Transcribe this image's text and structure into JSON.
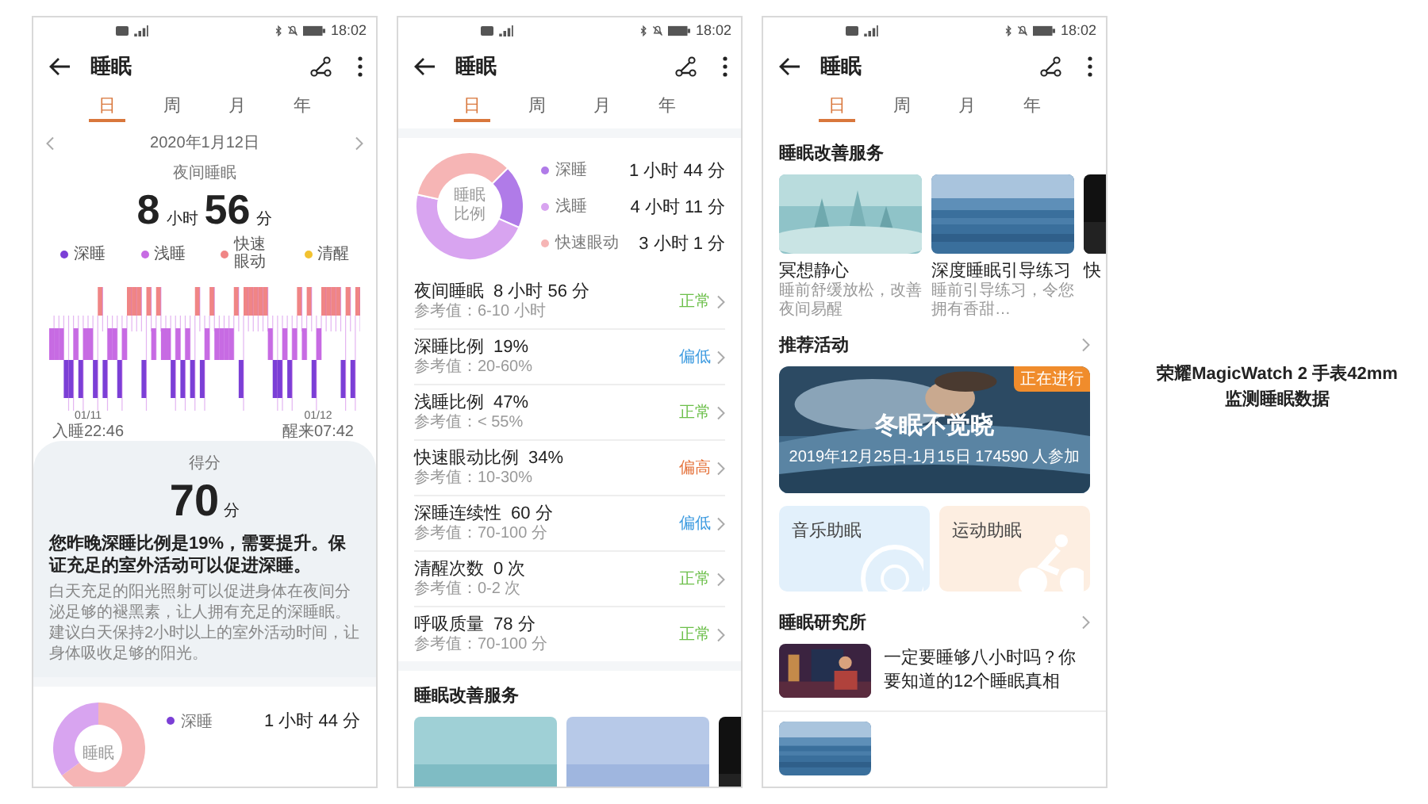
{
  "screens": [
    {
      "kind": "overview",
      "status_time": "18:02",
      "title": "睡眠",
      "tabs": [
        {
          "label": "日",
          "selected": true
        },
        {
          "label": "周",
          "selected": false
        },
        {
          "label": "月",
          "selected": false
        },
        {
          "label": "年",
          "selected": false
        }
      ],
      "date": "2020年1月12日",
      "night_label": "夜间睡眠",
      "duration": {
        "hours": "8",
        "hours_unit": "小时",
        "minutes": "56",
        "minutes_unit": "分"
      },
      "legend": [
        {
          "label": "深睡",
          "color": "#7b3fd6"
        },
        {
          "label": "浅睡",
          "color": "#c76be3"
        },
        {
          "label": "快速眼动",
          "color": "#f08585"
        },
        {
          "label": "清醒",
          "color": "#f2c230"
        }
      ],
      "chart_start": {
        "date": "01/11",
        "label": "入睡22:46"
      },
      "chart_end": {
        "date": "01/12",
        "label": "醒来07:42"
      },
      "score": {
        "label": "得分",
        "value": "70",
        "unit": "分"
      },
      "advice_title": "您昨晚深睡比例是19%，需要提升。保证充足的室外活动可以促进深睡。",
      "advice_body": "白天充足的阳光照射可以促进身体在夜间分泌足够的褪黑素，让人拥有充足的深睡眠。建议白天保持2小时以上的室外活动时间，让身体吸收足够的阳光。",
      "breakdown": {
        "center_label": "睡眠",
        "rows": [
          {
            "label": "深睡",
            "value": "1 小时 44 分",
            "color": "#7b3fd6"
          }
        ]
      }
    },
    {
      "kind": "details",
      "status_time": "18:02",
      "title": "睡眠",
      "tabs": [
        {
          "label": "日",
          "selected": true
        },
        {
          "label": "周",
          "selected": false
        },
        {
          "label": "月",
          "selected": false
        },
        {
          "label": "年",
          "selected": false
        }
      ],
      "chart_data": {
        "type": "donut",
        "title": "睡眠比例",
        "categories": [
          "深睡",
          "浅睡",
          "快速眼动"
        ],
        "values": [
          19,
          47,
          34
        ],
        "colors": [
          "#b07be8",
          "#d8a4f0",
          "#f6b5b5"
        ]
      },
      "durations": [
        "1 小时 44 分",
        "4 小时 11 分",
        "3 小时 1 分"
      ],
      "metrics": [
        {
          "title": "夜间睡眠",
          "value": "8 小时 56 分",
          "reference": "参考值：6-10 小时",
          "status": "正常",
          "color": "#6cbf4a"
        },
        {
          "title": "深睡比例",
          "value": "19%",
          "reference": "参考值：20-60%",
          "status": "偏低",
          "color": "#3d9be0"
        },
        {
          "title": "浅睡比例",
          "value": "47%",
          "reference": "参考值：< 55%",
          "status": "正常",
          "color": "#6cbf4a"
        },
        {
          "title": "快速眼动比例",
          "value": "34%",
          "reference": "参考值：10-30%",
          "status": "偏高",
          "color": "#e5743e"
        },
        {
          "title": "深睡连续性",
          "value": "60 分",
          "reference": "参考值：70-100 分",
          "status": "偏低",
          "color": "#3d9be0"
        },
        {
          "title": "清醒次数",
          "value": "0 次",
          "reference": "参考值：0-2 次",
          "status": "正常",
          "color": "#6cbf4a"
        },
        {
          "title": "呼吸质量",
          "value": "78 分",
          "reference": "参考值：70-100 分",
          "status": "正常",
          "color": "#6cbf4a"
        }
      ],
      "services_heading": "睡眠改善服务",
      "service_cards": [
        {
          "kind": "picture"
        },
        {
          "kind": "picture"
        },
        {
          "kind": "picture"
        }
      ]
    },
    {
      "kind": "services",
      "status_time": "18:02",
      "title": "睡眠",
      "tabs": [
        {
          "label": "日",
          "selected": true
        },
        {
          "label": "周",
          "selected": false
        },
        {
          "label": "月",
          "selected": false
        },
        {
          "label": "年",
          "selected": false
        }
      ],
      "services_heading": "睡眠改善服务",
      "service_cards": [
        {
          "title": "冥想静心",
          "subtitle": "睡前舒缓放松，改善夜间易醒"
        },
        {
          "title": "深度睡眠引导练习",
          "subtitle": "睡前引导练习，令您拥有香甜…"
        },
        {
          "title": "快"
        }
      ],
      "activities_heading": "推荐活动",
      "banner": {
        "badge": "正在进行",
        "title": "冬眠不觉晓",
        "subtitle": "2019年12月25日-1月15日  174590 人参加"
      },
      "tiles": [
        {
          "label": "音乐助眠",
          "kind": "music"
        },
        {
          "label": "运动助眠",
          "kind": "exercise"
        }
      ],
      "research_heading": "睡眠研究所",
      "articles": [
        {
          "title": "一定要睡够八小时吗？你要知道的12个睡眠真相"
        },
        {
          "kind": "picture"
        }
      ]
    }
  ],
  "caption": {
    "product": "荣耀MagicWatch 2 手表42mm",
    "subject": "监测睡眠数据"
  }
}
